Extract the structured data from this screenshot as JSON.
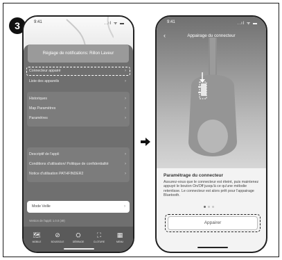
{
  "step_number": "3",
  "left_phone": {
    "status_time": "9:41",
    "status_icons": "..ıl ᯤ ▬",
    "notification_card": "Réglage de notifications: Rillon Laveur",
    "menu_top": [
      {
        "label": "Connecteur appairé"
      },
      {
        "label": "Liste des appareils"
      }
    ],
    "menu_mid": [
      {
        "label": "Historiques"
      },
      {
        "label": "Map Paramètres"
      },
      {
        "label": "Paramètres"
      }
    ],
    "menu_docs": [
      {
        "label": "Descriptif de l'appli"
      },
      {
        "label": "Conditions d'utilisation/ Politique de confidentialité"
      },
      {
        "label": "Notice d'utilisation PATHFINDER2"
      }
    ],
    "mode_label": "Mode Veille",
    "version": "Version de l'appli: 1.0.0 (49)",
    "tabs": [
      {
        "icon": "map-icon",
        "glyph": "🗺",
        "label": "MOBILE"
      },
      {
        "icon": "compass-icon",
        "glyph": "⊘",
        "label": "BOUSSOLE"
      },
      {
        "icon": "mower-icon",
        "glyph": "⛭",
        "label": "DÉBRAGE"
      },
      {
        "icon": "frame-icon",
        "glyph": "⛶",
        "label": "CLOTURE"
      },
      {
        "icon": "grid-icon",
        "glyph": "▦",
        "label": "MENU"
      }
    ]
  },
  "right_phone": {
    "status_time": "9:41",
    "status_icons": "..ıl ᯤ ▬",
    "nav_title": "Appairage du connecteur",
    "section_title": "Paramétrage du connecteur",
    "section_text": "Assurez-vous que le connecteur est éteint, puis maintenez appuyé le bouton On/Off jusqu'à ce qu'une mélodie retentisse. Le connecteur est alors prêt pour l'appairage Bluetooth.",
    "pair_button": "Appairer"
  },
  "colors": {
    "dark_gray": "#6f6f6f",
    "tab_bar": "#5a5a5a",
    "accent_white": "#ffffff"
  }
}
